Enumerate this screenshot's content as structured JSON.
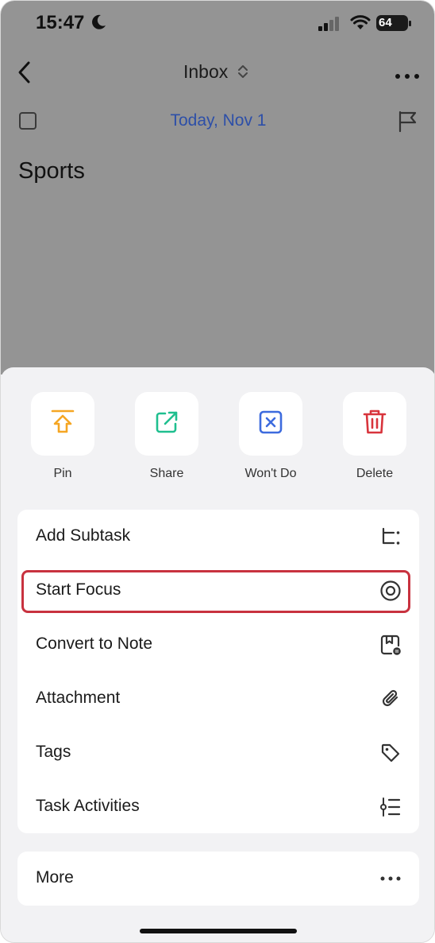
{
  "status_bar": {
    "time": "15:47",
    "battery": "64"
  },
  "nav": {
    "title": "Inbox"
  },
  "task": {
    "date": "Today, Nov 1",
    "title": "Sports"
  },
  "quick_actions": [
    {
      "label": "Pin",
      "icon": "pin-icon",
      "color": "#f5a623"
    },
    {
      "label": "Share",
      "icon": "share-icon",
      "color": "#1fbf8f"
    },
    {
      "label": "Won't Do",
      "icon": "wont-do-icon",
      "color": "#3d6bde"
    },
    {
      "label": "Delete",
      "icon": "trash-icon",
      "color": "#d8343c"
    }
  ],
  "menu": {
    "items": [
      {
        "label": "Add Subtask",
        "icon": "subtask-icon"
      },
      {
        "label": "Start Focus",
        "icon": "focus-icon",
        "highlighted": true
      },
      {
        "label": "Convert to Note",
        "icon": "note-icon"
      },
      {
        "label": "Attachment",
        "icon": "paperclip-icon"
      },
      {
        "label": "Tags",
        "icon": "tag-icon"
      },
      {
        "label": "Task Activities",
        "icon": "activities-icon"
      }
    ],
    "more_label": "More"
  },
  "colors": {
    "highlight": "#c8323f",
    "date_blue": "#2d4fa8",
    "overlay": "#949494"
  }
}
